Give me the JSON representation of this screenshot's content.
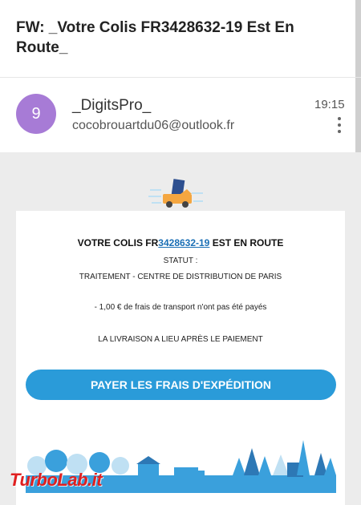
{
  "email": {
    "subject": "FW: _Votre Colis FR3428632-19 Est En Route_",
    "sender": {
      "avatar_letter": "9",
      "name": "_DigitsPro_",
      "email": "cocobrouartdu06@outlook.fr",
      "time": "19:15"
    }
  },
  "card": {
    "title_prefix": "VOTRE COLIS FR",
    "title_link": "3428632-19",
    "title_suffix": " EST EN ROUTE",
    "statut_label": "STATUT :",
    "statut_value": "TRAITEMENT - CENTRE DE DISTRIBUTION DE PARIS",
    "fee_line": "- 1,00 € de frais de transport n'ont pas été payés",
    "delivery_line": "LA LIVRAISON A LIEU APRÈS LE PAIEMENT",
    "pay_button": "PAYER LES FRAIS D'EXPÉDITION"
  },
  "watermark": "TurboLab.it",
  "colors": {
    "avatar": "#a77bd6",
    "link": "#1a6fb5",
    "button": "#2a9bd9",
    "scene": "#3aa0dc",
    "watermark": "#e02020"
  }
}
